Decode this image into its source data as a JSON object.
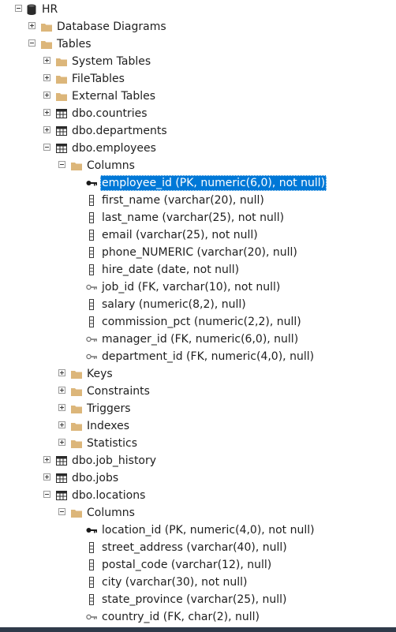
{
  "tree": {
    "db": "HR",
    "db_diagrams": "Database Diagrams",
    "tables": "Tables",
    "system_tables": "System Tables",
    "file_tables": "FileTables",
    "external_tables": "External Tables",
    "countries": "dbo.countries",
    "departments": "dbo.departments",
    "employees": {
      "label": "dbo.employees",
      "columns_label": "Columns",
      "columns": [
        "employee_id (PK, numeric(6,0), not null)",
        "first_name (varchar(20), null)",
        "last_name (varchar(25), not null)",
        "email (varchar(25), not null)",
        "phone_NUMERIC (varchar(20), null)",
        "hire_date (date, not null)",
        "job_id (FK, varchar(10), not null)",
        "salary (numeric(8,2), null)",
        "commission_pct (numeric(2,2), null)",
        "manager_id (FK, numeric(6,0), null)",
        "department_id (FK, numeric(4,0), null)"
      ],
      "keys": "Keys",
      "constraints": "Constraints",
      "triggers": "Triggers",
      "indexes": "Indexes",
      "statistics": "Statistics"
    },
    "job_history": "dbo.job_history",
    "jobs": "dbo.jobs",
    "locations": {
      "label": "dbo.locations",
      "columns_label": "Columns",
      "columns": [
        "location_id (PK, numeric(4,0), not null)",
        "street_address (varchar(40), null)",
        "postal_code (varchar(12), null)",
        "city (varchar(30), not null)",
        "state_province (varchar(25), null)",
        "country_id (FK, char(2), null)"
      ]
    }
  },
  "colors": {
    "selection": "#0078d7",
    "folder": "#dcb67a",
    "key_pk": "#1a1a1a",
    "key_fk": "#707070"
  }
}
